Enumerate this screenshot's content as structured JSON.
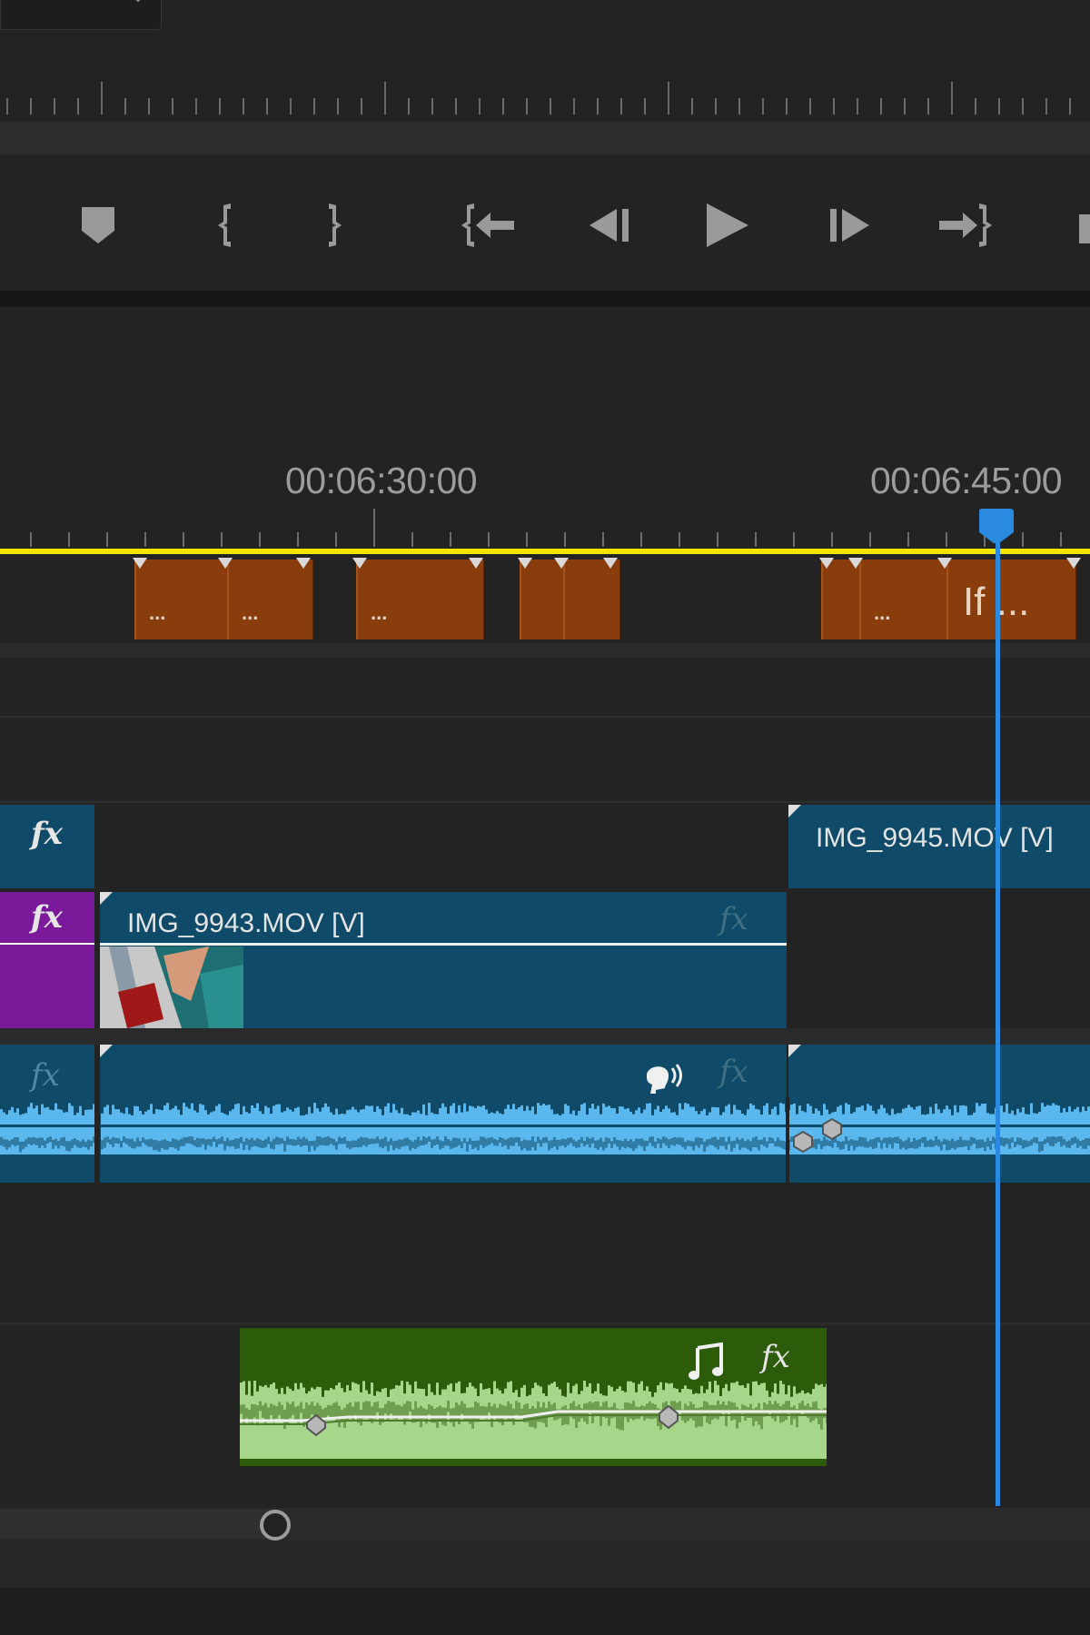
{
  "source_monitor": {
    "transport_buttons": [
      {
        "name": "add-marker-button",
        "icon": "marker-icon"
      },
      {
        "name": "mark-in-button",
        "icon": "mark-in-icon"
      },
      {
        "name": "mark-out-button",
        "icon": "mark-out-icon"
      },
      {
        "name": "go-to-in-button",
        "icon": "go-to-in-icon"
      },
      {
        "name": "step-back-button",
        "icon": "step-back-icon"
      },
      {
        "name": "play-button",
        "icon": "play-icon"
      },
      {
        "name": "step-forward-button",
        "icon": "step-forward-icon"
      },
      {
        "name": "go-to-out-button",
        "icon": "go-to-out-icon"
      }
    ]
  },
  "timeline": {
    "timecodes": [
      "00:06:30:00",
      "00:06:45:00"
    ],
    "caption_clips": [
      {
        "label": "..."
      },
      {
        "label": "..."
      },
      {
        "label": "..."
      },
      {
        "label": ""
      },
      {
        "label": ""
      },
      {
        "label": ""
      },
      {
        "label": "..."
      },
      {
        "label": "If ..."
      }
    ],
    "video_tracks": {
      "v2": {
        "fx": "fx",
        "clip_label": "IMG_9945.MOV [V]"
      },
      "v1": {
        "fx": "fx",
        "clip_label": "IMG_9943.MOV [V]",
        "clip_fx": "fx"
      }
    },
    "audio_tracks": {
      "a1": {
        "fx": "fx",
        "clip_fx": "fx",
        "icon": "speech-icon"
      },
      "music": {
        "fx": "fx",
        "icon": "music-note-icon"
      }
    }
  },
  "colors": {
    "playhead": "#2a8ae0",
    "caption": "#8a3d0c",
    "video_clip": "#0f4a68",
    "audio_wave": "#5ab8ef",
    "music_clip": "#2c5c0a",
    "music_wave": "#a6d68a",
    "work_area": "#f2e600",
    "v1_header": "#7a1a9a"
  }
}
